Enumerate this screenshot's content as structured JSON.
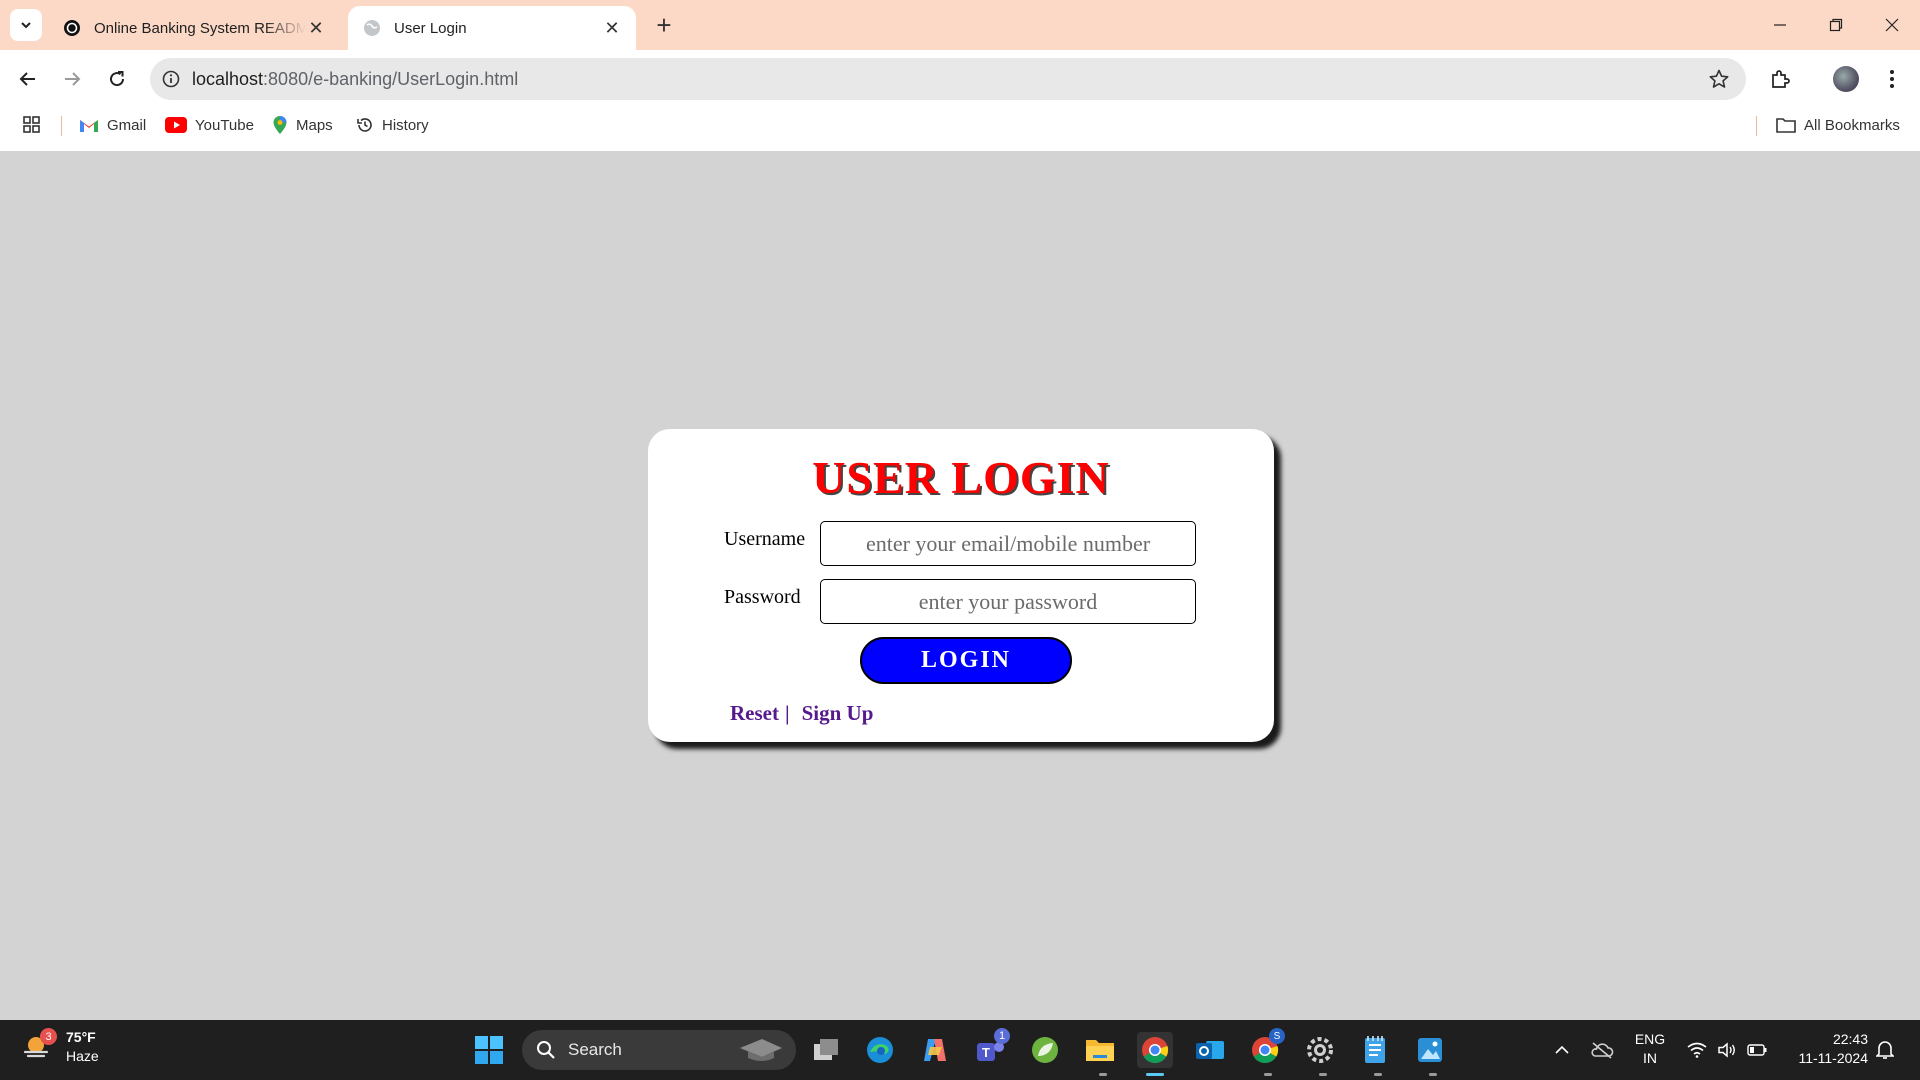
{
  "browser": {
    "tabs": [
      {
        "title": "Online Banking System README",
        "active": false
      },
      {
        "title": "User Login",
        "active": true
      }
    ],
    "url_host": "localhost",
    "url_rest": ":8080/e-banking/UserLogin.html",
    "bookmarks": [
      {
        "label": "Gmail",
        "icon": "gmail-icon"
      },
      {
        "label": "YouTube",
        "icon": "youtube-icon"
      },
      {
        "label": "Maps",
        "icon": "maps-icon"
      },
      {
        "label": "History",
        "icon": "history-icon"
      }
    ],
    "all_bookmarks_label": "All Bookmarks"
  },
  "login": {
    "title": "USER LOGIN",
    "username_label": "Username",
    "username_placeholder": "enter your email/mobile number",
    "username_value": "",
    "password_label": "Password",
    "password_placeholder": "enter your password",
    "password_value": "",
    "login_button": "LOGIN",
    "reset_link": "Reset",
    "link_separator": "|",
    "signup_link": "Sign Up"
  },
  "taskbar": {
    "weather_temp": "75°F",
    "weather_desc": "Haze",
    "weather_badge": "3",
    "search_label": "Search",
    "lang_line1": "ENG",
    "lang_line2": "IN",
    "time": "22:43",
    "date": "11-11-2024",
    "teams_badge": "1",
    "chrome2_badge": "S"
  },
  "colors": {
    "page_bg": "#d3d3d3",
    "title_red": "#ff0000",
    "button_blue": "#0000ff",
    "link_purple": "#551a8b",
    "tab_strip": "#fbd9c6"
  }
}
